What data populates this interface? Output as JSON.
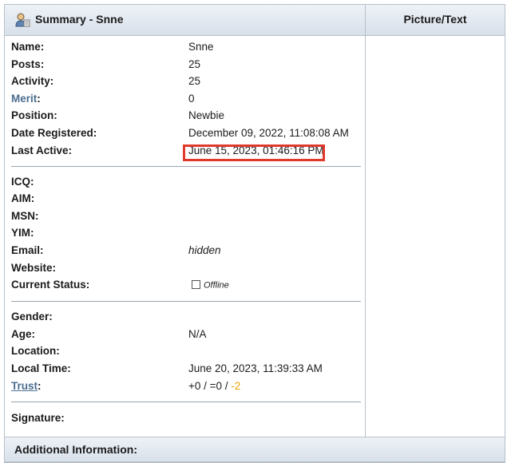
{
  "header": {
    "title": "Summary - Snne",
    "picture_text": "Picture/Text",
    "user_icon": "user-profile-icon"
  },
  "profile": {
    "name": {
      "label": "Name:",
      "value": "Snne"
    },
    "posts": {
      "label": "Posts:",
      "value": "25"
    },
    "activity": {
      "label": "Activity:",
      "value": "25"
    },
    "merit": {
      "label": "Merit",
      "label_suffix": ":",
      "value": "0"
    },
    "position": {
      "label": "Position:",
      "value": "Newbie"
    },
    "date_registered": {
      "label": "Date Registered:",
      "value": "December 09, 2022, 11:08:08 AM"
    },
    "last_active": {
      "label": "Last Active:",
      "value": "June 15, 2023, 01:46:16 PM"
    }
  },
  "contact": {
    "icq": {
      "label": "ICQ:",
      "value": ""
    },
    "aim": {
      "label": "AIM:",
      "value": ""
    },
    "msn": {
      "label": "MSN:",
      "value": ""
    },
    "yim": {
      "label": "YIM:",
      "value": ""
    },
    "email": {
      "label": "Email:",
      "value": "hidden"
    },
    "website": {
      "label": "Website:",
      "value": ""
    },
    "current_status": {
      "label": "Current Status:",
      "value": "Offline"
    }
  },
  "personal": {
    "gender": {
      "label": "Gender:",
      "value": ""
    },
    "age": {
      "label": "Age:",
      "value": "N/A"
    },
    "location": {
      "label": "Location:",
      "value": ""
    },
    "local_time": {
      "label": "Local Time:",
      "value": "June 20, 2023, 11:39:33 AM"
    },
    "trust": {
      "label": "Trust",
      "label_suffix": ":",
      "value_prefix": "+0 / =0 / ",
      "value_negative": "-2"
    }
  },
  "signature": {
    "label": "Signature:"
  },
  "additional": {
    "title": "Additional Information:"
  },
  "colors": {
    "highlight_border": "#e0392b",
    "link": "#4b6d8f",
    "negative_trust": "#f0a400",
    "header_bg": "#d8e0ea"
  }
}
